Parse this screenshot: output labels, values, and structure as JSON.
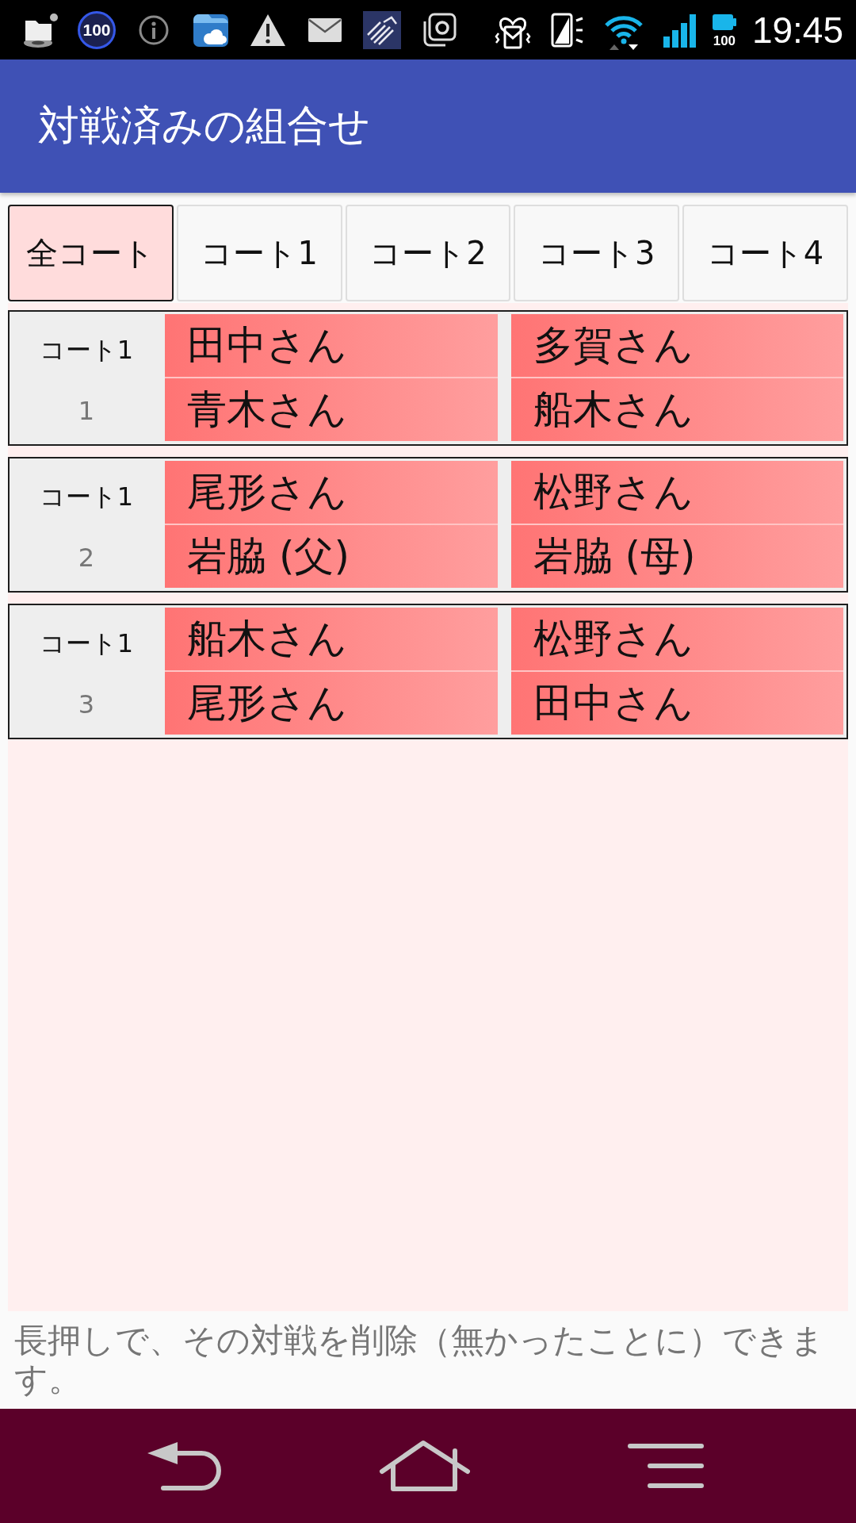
{
  "status_bar": {
    "notification_count": "100",
    "battery_percent": "100",
    "time": "19:45"
  },
  "app_bar": {
    "title": "対戦済みの組合せ"
  },
  "tabs": [
    {
      "label": "全コート",
      "selected": true
    },
    {
      "label": "コート1",
      "selected": false
    },
    {
      "label": "コート2",
      "selected": false
    },
    {
      "label": "コート3",
      "selected": false
    },
    {
      "label": "コート4",
      "selected": false
    }
  ],
  "matches": [
    {
      "court": "コート1",
      "number": "1",
      "team_1": [
        "田中さん",
        "青木さん"
      ],
      "team_2": [
        "多賀さん",
        "船木さん"
      ]
    },
    {
      "court": "コート1",
      "number": "2",
      "team_1": [
        "尾形さん",
        "岩脇 (父)"
      ],
      "team_2": [
        "松野さん",
        "岩脇 (母)"
      ]
    },
    {
      "court": "コート1",
      "number": "3",
      "team_1": [
        "船木さん",
        "尾形さん"
      ],
      "team_2": [
        "松野さん",
        "田中さん"
      ]
    }
  ],
  "hint": "長押しで、その対戦を削除（無かったことに）できます。"
}
